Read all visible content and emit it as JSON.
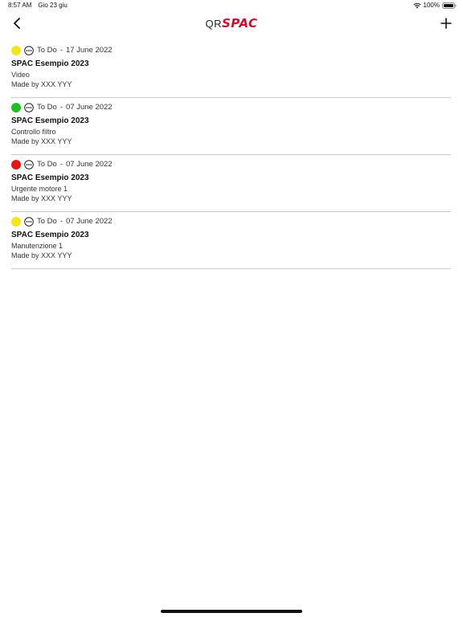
{
  "status_bar": {
    "time": "8:57 AM",
    "date": "Gio 23 giu",
    "battery": "100%"
  },
  "nav": {
    "logo_prefix": "QR",
    "logo_brand": "SPAC",
    "brand_color": "#c8102e",
    "back_icon": "chevron-left-icon",
    "add_icon": "plus-icon"
  },
  "tasks": [
    {
      "status_color": "#f5e61b",
      "status": "To Do",
      "separator": "-",
      "date": "17 June 2022",
      "title": "SPAC Esempio 2023",
      "subtitle": "Video",
      "author": "Made by XXX YYY"
    },
    {
      "status_color": "#1fc21f",
      "status": "To Do",
      "separator": "-",
      "date": "07 June 2022",
      "title": "SPAC Esempio 2023",
      "subtitle": "Controllo filtro",
      "author": "Made by XXX YYY"
    },
    {
      "status_color": "#e81414",
      "status": "To Do",
      "separator": "-",
      "date": "07 June 2022",
      "title": "SPAC Esempio 2023",
      "subtitle": "Urgente motore 1",
      "author": "Made by XXX YYY"
    },
    {
      "status_color": "#f5e61b",
      "status": "To Do",
      "separator": "-",
      "date": "07 June 2022",
      "title": "SPAC Esempio 2023",
      "subtitle": "Manutenzione 1",
      "author": "Made by XXX YYY"
    }
  ]
}
